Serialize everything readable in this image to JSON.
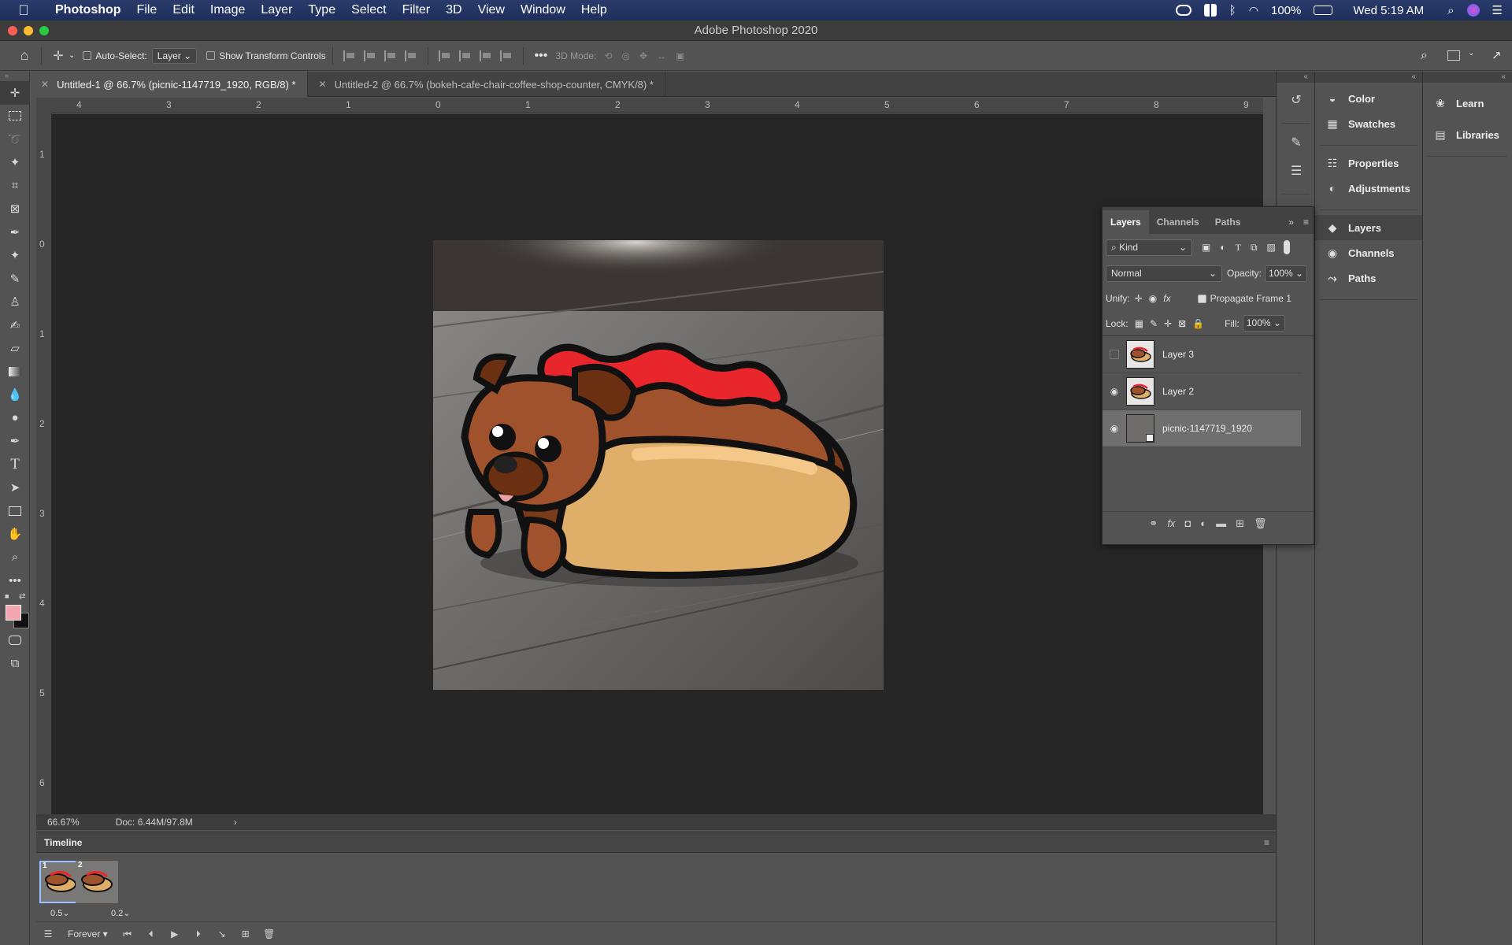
{
  "menubar": {
    "app_name": "Photoshop",
    "menus": [
      "File",
      "Edit",
      "Image",
      "Layer",
      "Type",
      "Select",
      "Filter",
      "3D",
      "View",
      "Window",
      "Help"
    ],
    "battery": "100%",
    "clock": "Wed 5:19 AM"
  },
  "window": {
    "title": "Adobe Photoshop 2020"
  },
  "options": {
    "auto_select_label": "Auto-Select:",
    "auto_select_value": "Layer",
    "show_transform_label": "Show Transform Controls",
    "mode_3d_label": "3D Mode:"
  },
  "tabs": [
    {
      "label": "Untitled-1 @ 66.7% (picnic-1147719_1920, RGB/8) *"
    },
    {
      "label": "Untitled-2 @ 66.7% (bokeh-cafe-chair-coffee-shop-counter, CMYK/8) *"
    }
  ],
  "ruler": {
    "top": [
      "4",
      "3",
      "2",
      "1",
      "0",
      "1",
      "2",
      "3",
      "4",
      "5",
      "6",
      "7",
      "8",
      "9"
    ],
    "left": [
      "1",
      "0",
      "1",
      "2",
      "3",
      "4",
      "5",
      "6"
    ]
  },
  "status": {
    "zoom": "66.67%",
    "doc": "Doc: 6.44M/97.8M"
  },
  "timeline": {
    "title": "Timeline",
    "frames": [
      {
        "num": "1",
        "delay": "0.5"
      },
      {
        "num": "2",
        "delay": "0.2"
      }
    ],
    "loop": "Forever"
  },
  "dock1": {
    "items": [
      {
        "label": "Color",
        "icon": "color-palette-icon"
      },
      {
        "label": "Swatches",
        "icon": "swatches-grid-icon"
      },
      {
        "label": "Properties",
        "icon": "properties-icon"
      },
      {
        "label": "Adjustments",
        "icon": "adjustments-icon"
      },
      {
        "label": "Layers",
        "icon": "layers-stack-icon"
      },
      {
        "label": "Channels",
        "icon": "channels-icon"
      },
      {
        "label": "Paths",
        "icon": "paths-icon"
      }
    ]
  },
  "dock2": {
    "items": [
      {
        "label": "Learn",
        "icon": "lightbulb-icon"
      },
      {
        "label": "Libraries",
        "icon": "libraries-icon"
      }
    ]
  },
  "layers_panel": {
    "tabs": [
      "Layers",
      "Channels",
      "Paths"
    ],
    "filter": "Kind",
    "blend_mode": "Normal",
    "opacity_label": "Opacity:",
    "opacity": "100%",
    "unify_label": "Unify:",
    "propagate_label": "Propagate Frame 1",
    "lock_label": "Lock:",
    "fill_label": "Fill:",
    "fill": "100%",
    "layers": [
      {
        "name": "Layer 3",
        "visible": false
      },
      {
        "name": "Layer 2",
        "visible": true
      },
      {
        "name": "picnic-1147719_1920",
        "visible": true
      }
    ]
  },
  "colors": {
    "foreground": "#f4a6b0",
    "background": "#111111",
    "canvas_bg": "#262626",
    "menubar": "#1f3260"
  }
}
